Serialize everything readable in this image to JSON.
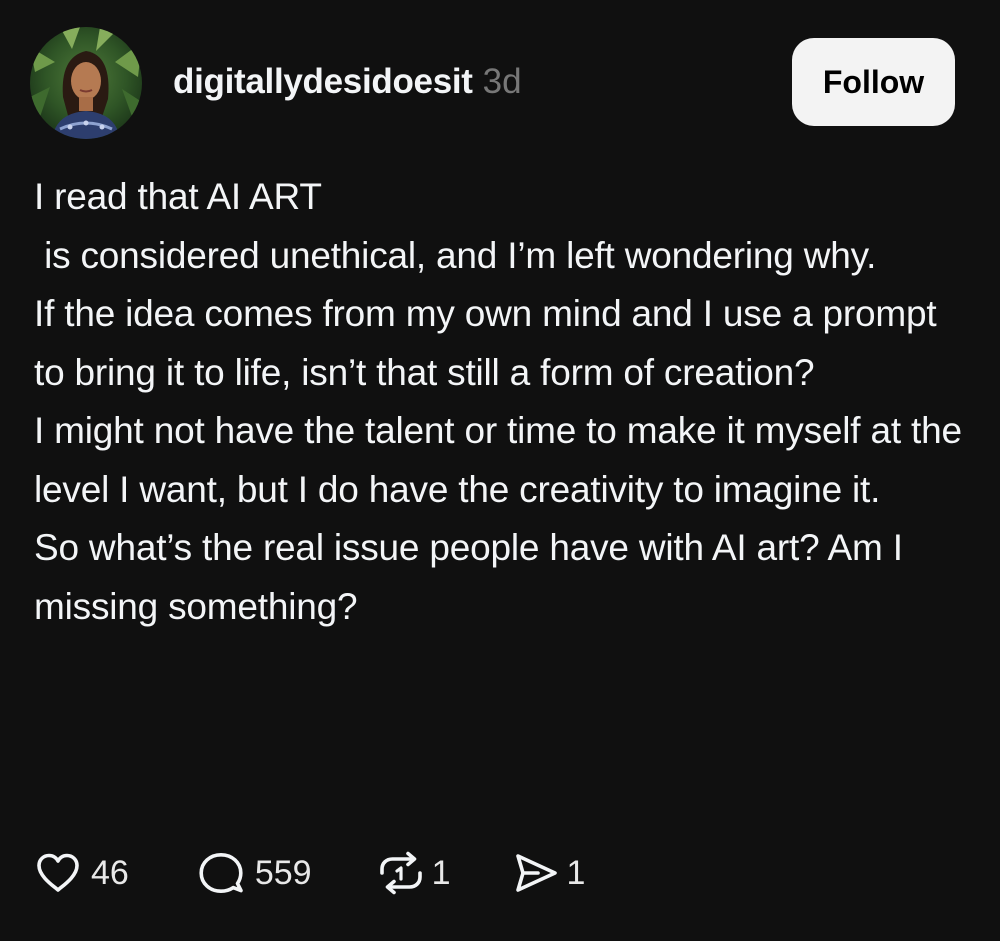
{
  "post": {
    "username": "digitallydesidoesit",
    "timestamp": "3d",
    "follow_label": "Follow",
    "text": "I read that AI ART\n is considered unethical, and I’m left wondering why.\nIf the idea comes from my own mind and I use a prompt to bring it to life, isn’t that still a form of creation?\nI might not have the talent or time to make it myself at the level I want, but I do have the creativity to imagine it.\nSo what’s the real issue people have with AI art? Am I missing something?",
    "actions": {
      "likes": "46",
      "comments": "559",
      "reposts": "1",
      "shares": "1"
    }
  },
  "icons": {
    "like": "heart-icon",
    "comment": "comment-bubble-icon",
    "repost": "repost-icon",
    "share": "send-icon"
  },
  "colors": {
    "background": "#101010",
    "text": "#f3f5f7",
    "secondary_text": "#777777",
    "follow_button_bg": "#f3f3f3",
    "follow_button_text": "#000000"
  }
}
